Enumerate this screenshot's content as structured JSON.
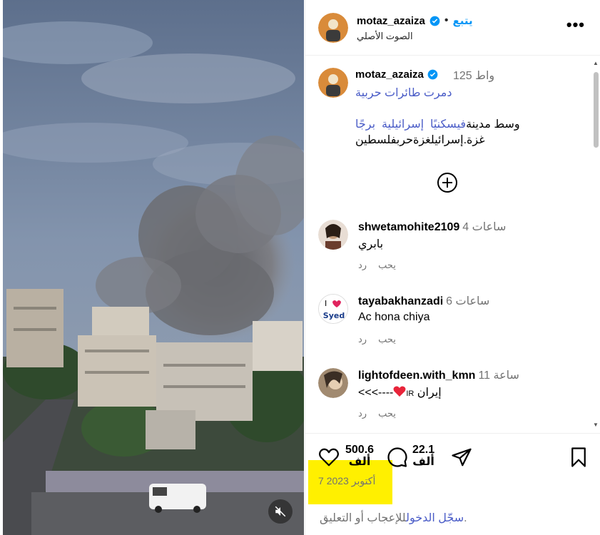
{
  "post": {
    "username": "motaz_azaiza",
    "follow_label": "يتبع",
    "audio_label": "الصوت الأصلي",
    "more_label": "•••"
  },
  "caption": {
    "username": "motaz_azaiza",
    "time": "125 واط",
    "line1": "دمرت طائرات حربية",
    "body_prefix": "وسط مدينة",
    "tags": [
      "في",
      "سكنيًا",
      "إسرائيلية",
      "برجًا"
    ],
    "line2": "غزة.إسرائيلغزةحربفلسطين"
  },
  "comments": [
    {
      "username": "shwetamohite2109",
      "time": "4 ساعات",
      "text": "بابري",
      "reply": "رد",
      "like": "يحب"
    },
    {
      "username": "tayabakhanzadi",
      "time": "6 ساعات",
      "text": "Ac hona chiya",
      "reply": "رد",
      "like": "يحب",
      "avatar_text": "Syed"
    },
    {
      "username": "lightofdeen.with_kmn",
      "time": "11 ساعة",
      "text_prefix": "إيران",
      "text_suffix": "IR",
      "text_arrow": "<<<----",
      "reply": "رد",
      "like": "يحب"
    }
  ],
  "actions": {
    "likes": "500.6",
    "likes_unit": "ألف",
    "comments": "22.1",
    "comments_unit": "ألف",
    "date": "7 أكتوبر 2023",
    "login_link": "سجّل الدخول",
    "login_suffix": "للإعجاب أو التعليق."
  },
  "colors": {
    "accent": "#0095f6",
    "link": "#4a5cc7",
    "highlight": "#fff000"
  }
}
